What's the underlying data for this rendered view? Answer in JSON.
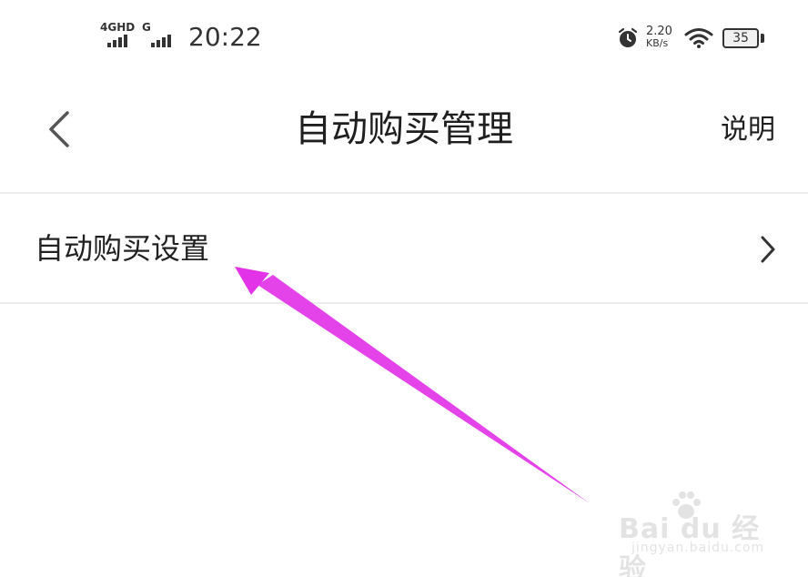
{
  "status_bar": {
    "network_1": "4GHD",
    "network_2": "G",
    "time": "20:22",
    "speed_value": "2.20",
    "speed_unit": "KB/s",
    "battery": "35",
    "icons": [
      "signal-bars-icon",
      "alarm-icon",
      "wifi-icon",
      "battery-icon"
    ]
  },
  "header": {
    "back_icon": "chevron-left-icon",
    "title": "自动购买管理",
    "help_label": "说明"
  },
  "list": {
    "items": [
      {
        "label": "自动购买设置",
        "icon": "chevron-right-icon"
      }
    ]
  },
  "annotation": {
    "arrow_color": "#e233e8"
  },
  "watermark": {
    "brand": "Bai du 经验",
    "url": "jingyan.baidu.com"
  }
}
